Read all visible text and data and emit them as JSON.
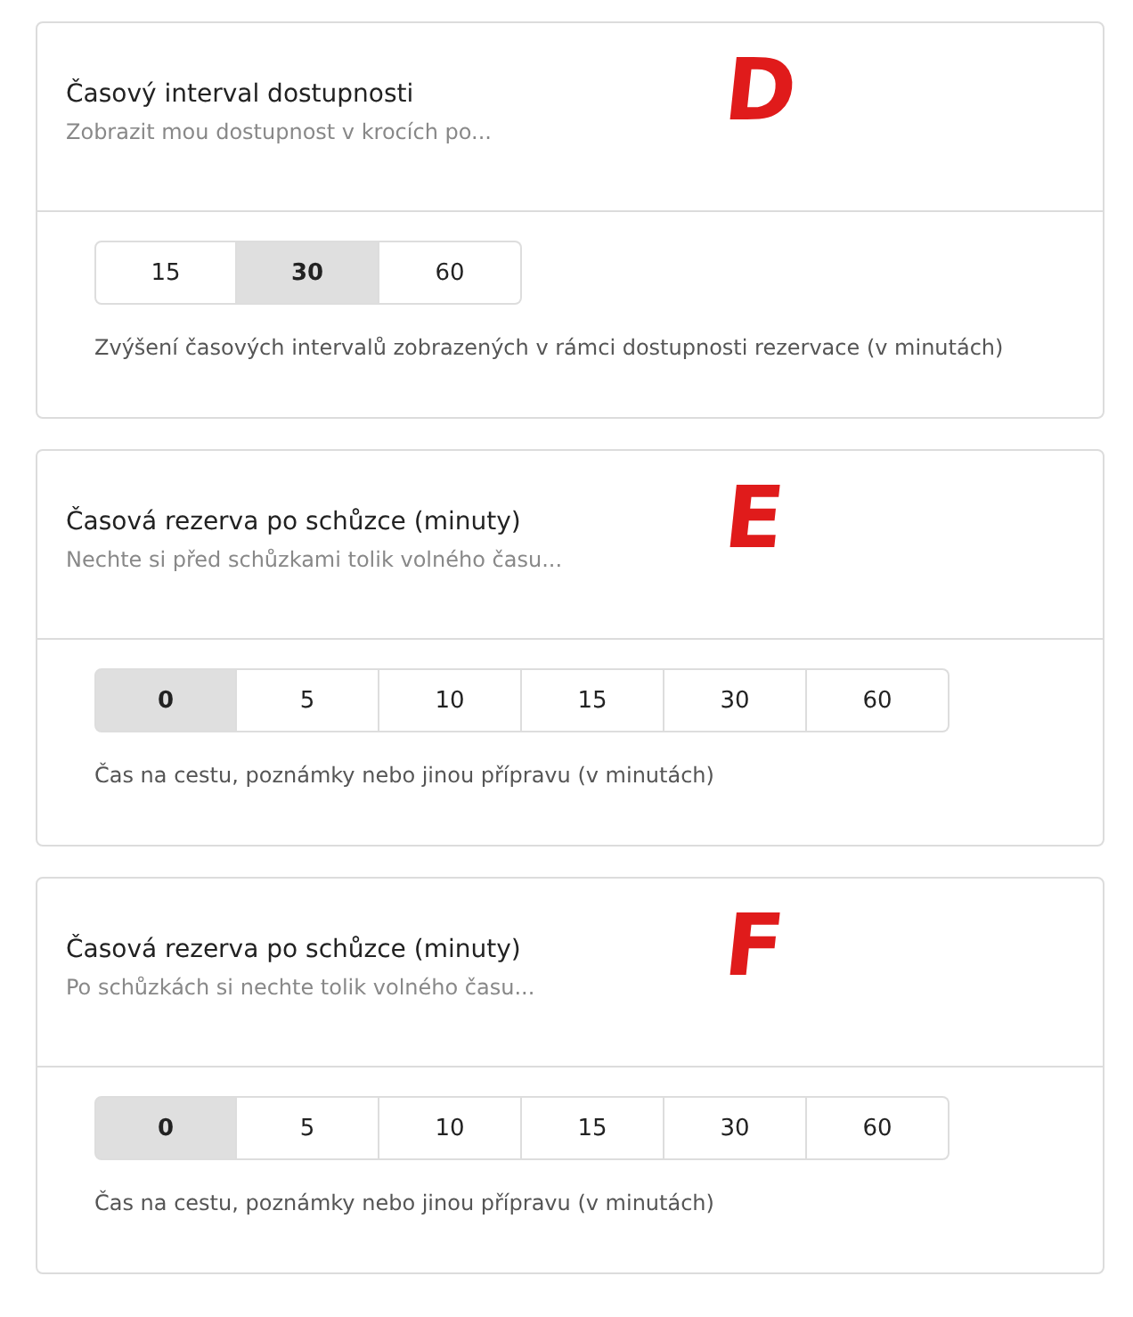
{
  "cards": [
    {
      "title": "Časový interval dostupnosti",
      "subtitle": "Zobrazit mou dostupnost v krocích po...",
      "annotation": "D",
      "options": [
        {
          "label": "15",
          "selected": false
        },
        {
          "label": "30",
          "selected": true
        },
        {
          "label": "60",
          "selected": false
        }
      ],
      "help": "Zvýšení časových intervalů zobrazených v rámci dostupnosti rezervace (v minutách)"
    },
    {
      "title": "Časová rezerva po schůzce (minuty)",
      "subtitle": "Nechte si před schůzkami tolik volného času...",
      "annotation": "E",
      "options": [
        {
          "label": "0",
          "selected": true
        },
        {
          "label": "5",
          "selected": false
        },
        {
          "label": "10",
          "selected": false
        },
        {
          "label": "15",
          "selected": false
        },
        {
          "label": "30",
          "selected": false
        },
        {
          "label": "60",
          "selected": false
        }
      ],
      "help": "Čas na cestu, poznámky nebo jinou přípravu (v minutách)"
    },
    {
      "title": "Časová rezerva po schůzce (minuty)",
      "subtitle": "Po schůzkách si nechte tolik volného času...",
      "annotation": "F",
      "options": [
        {
          "label": "0",
          "selected": true
        },
        {
          "label": "5",
          "selected": false
        },
        {
          "label": "10",
          "selected": false
        },
        {
          "label": "15",
          "selected": false
        },
        {
          "label": "30",
          "selected": false
        },
        {
          "label": "60",
          "selected": false
        }
      ],
      "help": "Čas na cestu, poznámky nebo jinou přípravu (v minutách)"
    }
  ]
}
